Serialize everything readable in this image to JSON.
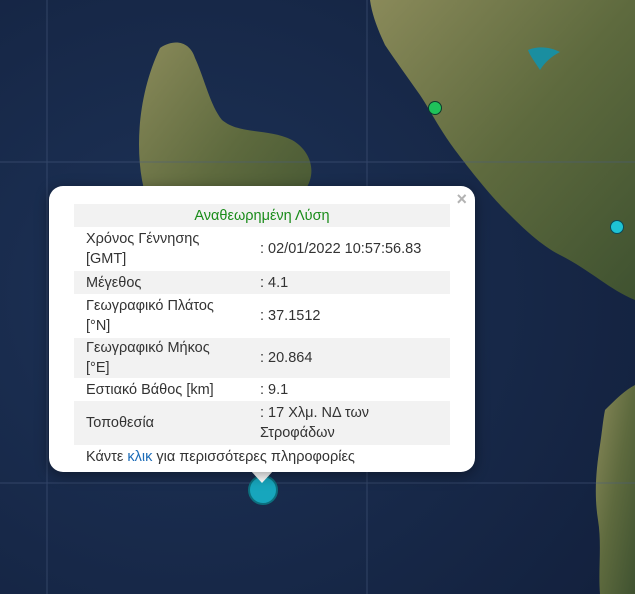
{
  "popup": {
    "title": "Αναθεωρημένη Λύση",
    "close": "×",
    "rows": [
      {
        "label": "Χρόνος Γέννησης [GMT]",
        "value": ": 02/01/2022 10:57:56.83"
      },
      {
        "label": "Μέγεθος",
        "value": ": 4.1"
      },
      {
        "label": "Γεωγραφικό Πλάτος [°N]",
        "value": ": 37.1512"
      },
      {
        "label": "Γεωγραφικό Μήκος [°E]",
        "value": ": 20.864"
      },
      {
        "label": "Εστιακό Βάθος [km]",
        "value": ": 9.1"
      },
      {
        "label": "Τοποθεσία",
        "value": ": 17 Χλμ. ΝΔ των Στροφάδων"
      }
    ],
    "footer": {
      "prefix": "Κάντε ",
      "link": "κλικ",
      "suffix": " για περισσότερες πληροφορίες"
    }
  },
  "markers": {
    "main_color": "#17a6bd",
    "green_color": "#1fc25a",
    "cyan_color": "#1ec3d4"
  },
  "colors": {
    "sea": "#172a4a",
    "land": "#5e6a3e",
    "grid": "#4a5c80"
  }
}
